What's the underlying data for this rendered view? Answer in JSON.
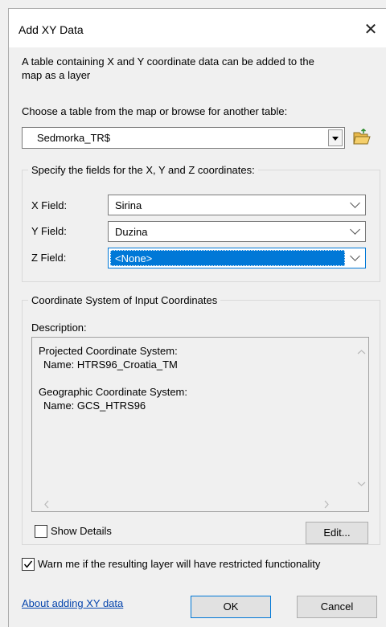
{
  "window": {
    "title": "Add XY Data"
  },
  "intro": {
    "line1": "A table containing X and Y coordinate data can be added to the",
    "line2": "map as a layer"
  },
  "table": {
    "prompt": "Choose a table from the map or browse for another table:",
    "selected": "Sedmorka_TR$"
  },
  "fields_group": {
    "legend": "Specify the fields for the X, Y and Z coordinates:",
    "x_label": "X Field:",
    "x_value": "Sirina",
    "y_label": "Y Field:",
    "y_value": "Duzina",
    "z_label": "Z Field:",
    "z_value": "<None>"
  },
  "coord_group": {
    "legend": "Coordinate System of Input Coordinates",
    "description_label": "Description:",
    "projected_title": "Projected Coordinate System:",
    "projected_name": "Name: HTRS96_Croatia_TM",
    "geographic_title": "Geographic Coordinate System:",
    "geographic_name": "Name: GCS_HTRS96",
    "show_details": "Show Details",
    "show_details_checked": false,
    "edit_label": "Edit..."
  },
  "warn": {
    "label": "Warn me if the resulting layer will have restricted functionality",
    "checked": true
  },
  "footer": {
    "about_link": "About adding XY data",
    "ok": "OK",
    "cancel": "Cancel"
  },
  "colors": {
    "selection": "#0078d7",
    "link": "#0645ad",
    "folder": "#e8b84a"
  }
}
